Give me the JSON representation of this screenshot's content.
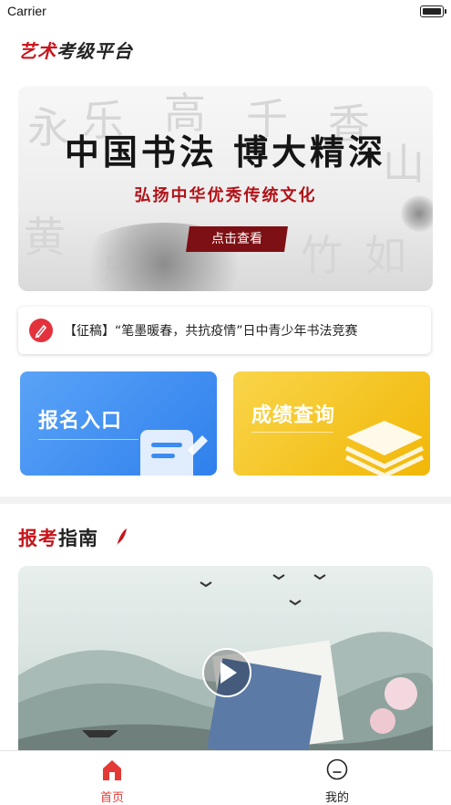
{
  "status_bar": {
    "carrier": "Carrier"
  },
  "header": {
    "title_part1": "艺术",
    "title_part2": "考级平台"
  },
  "banner": {
    "title": "中国书法 博大精深",
    "subtitle": "弘扬中华优秀传统文化",
    "button_label": "点击查看"
  },
  "notice": {
    "text": "【征稿】“笔墨暖春，共抗疫情”日中青少年书法竞赛"
  },
  "cards": [
    {
      "label": "报名入口",
      "color": "#3b8cf2"
    },
    {
      "label": "成绩查询",
      "color": "#f5c51c"
    }
  ],
  "guide": {
    "title_part1": "报考",
    "title_part2": "指南"
  },
  "tabbar": {
    "items": [
      {
        "label": "首页",
        "icon": "home-icon",
        "active": true
      },
      {
        "label": "我的",
        "icon": "profile-icon",
        "active": false
      }
    ]
  },
  "colors": {
    "accent": "#c8161d",
    "tab_active": "#e53935"
  }
}
